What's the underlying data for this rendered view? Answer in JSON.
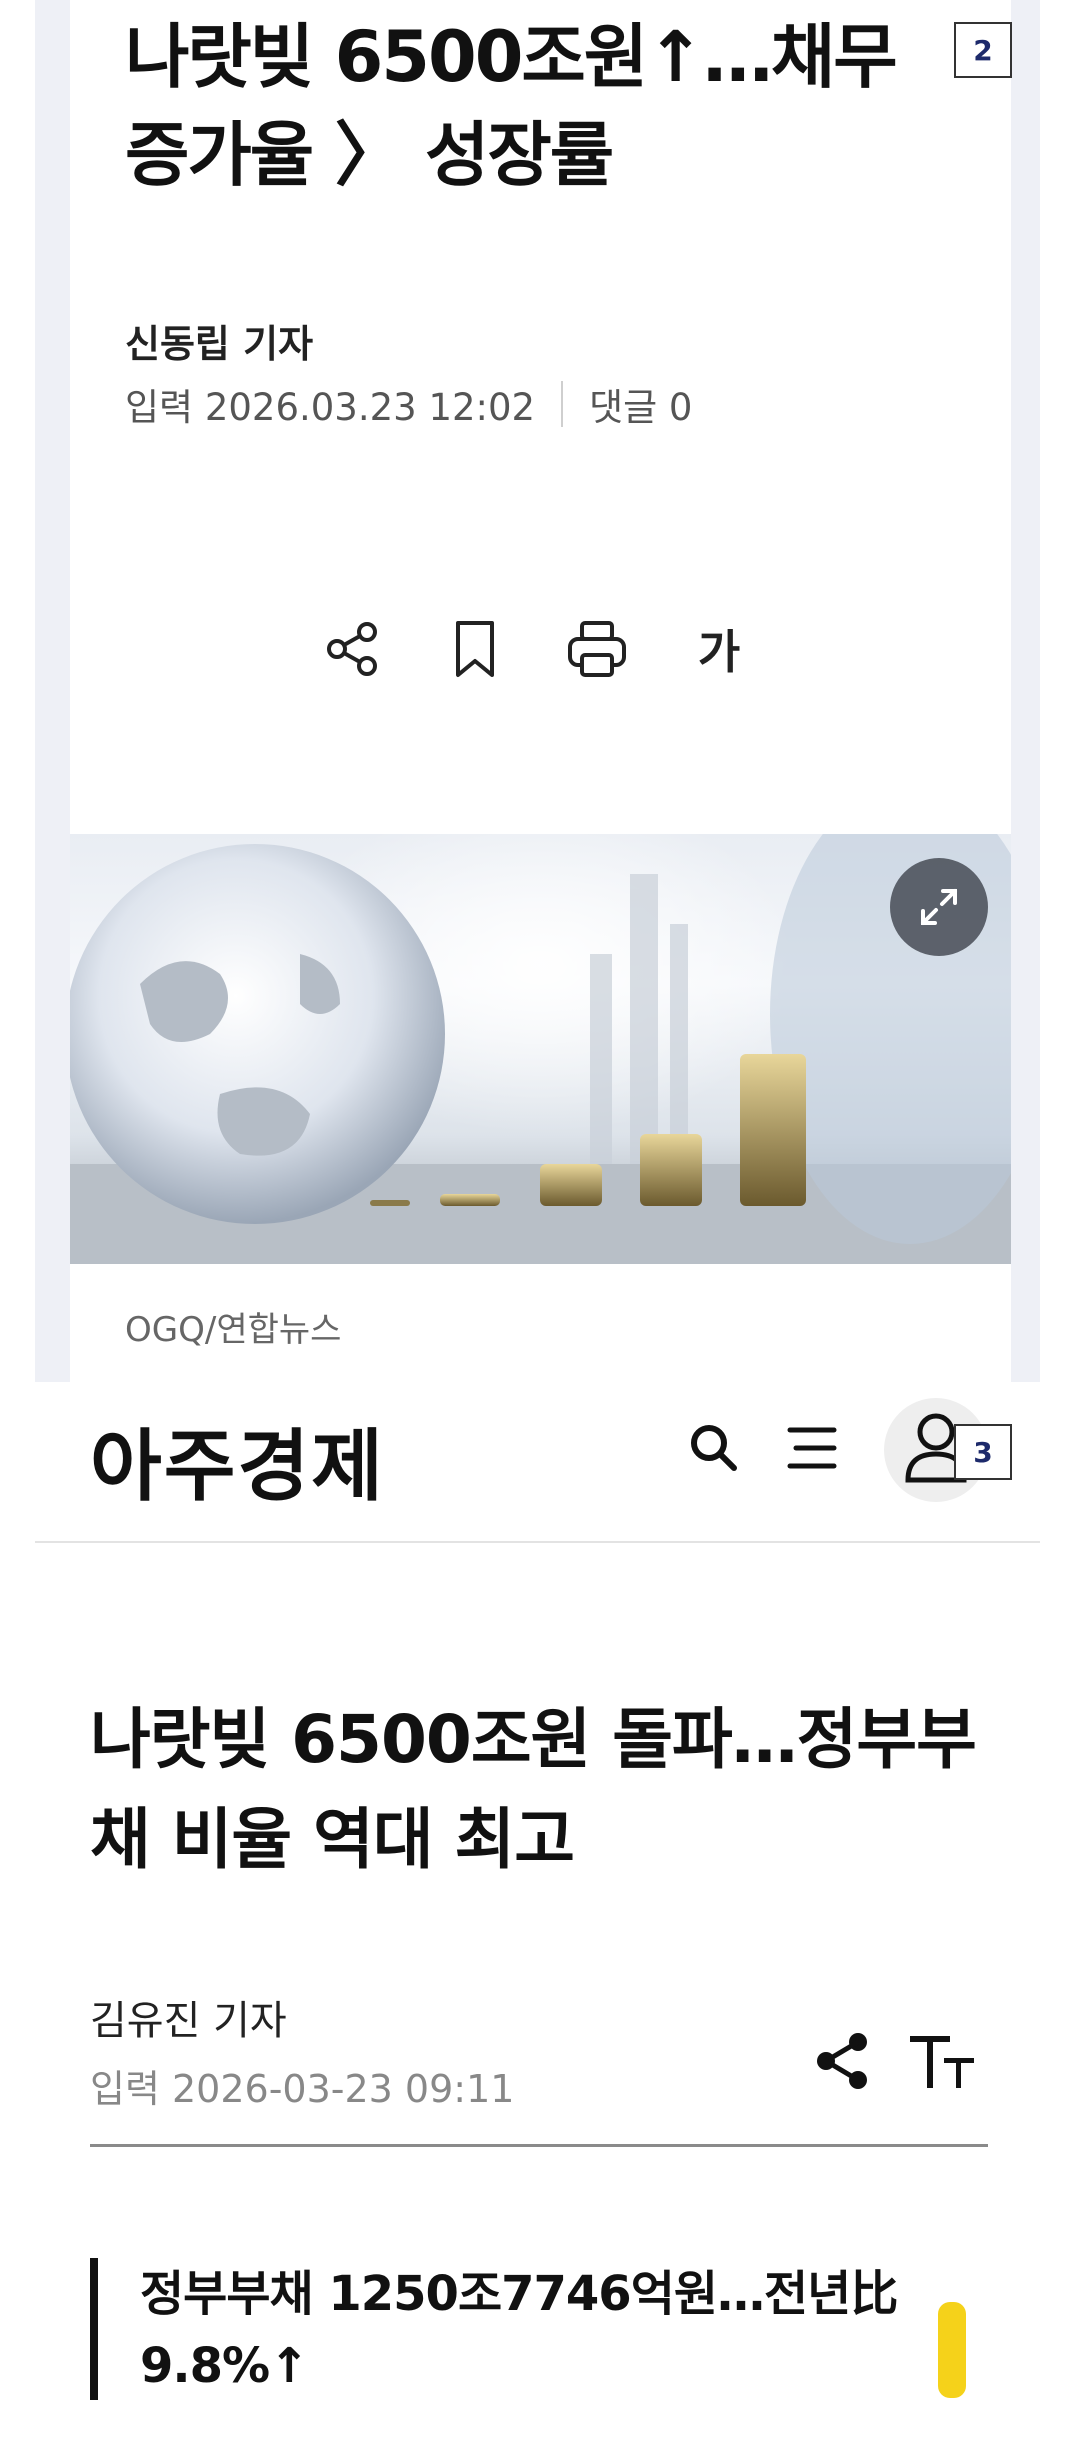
{
  "panel2": {
    "label": "2",
    "title": "나랏빚 6500조원↑…채무증가율 〉 성장률",
    "reporter": "신동립 기자",
    "date_text": "입력 2026.03.23 12:02",
    "comments_text": "댓글 0",
    "toolbar": {
      "icons": [
        "share-icon",
        "bookmark-icon",
        "print-icon"
      ],
      "font_size_label": "가"
    },
    "image_caption": "OGQ/연합뉴스"
  },
  "panel3": {
    "label": "3",
    "logo": "아주경제",
    "header_icons": [
      "search-icon",
      "menu-icon",
      "user-icon"
    ],
    "title": "나랏빚 6500조원 돌파…정부부채 비율 역대 최고",
    "reporter": "김유진 기자",
    "date_text": "입력 2026-03-23 09:11",
    "toolbar_icons": [
      "share-icon",
      "font-size-icon"
    ],
    "subheading": "정부부채 1250조7746억원…전년比 9.8%↑"
  },
  "colors": {
    "panel_background": "#eef0f6",
    "label_text": "#1d2a6b",
    "highlight": "#f5d21a"
  }
}
